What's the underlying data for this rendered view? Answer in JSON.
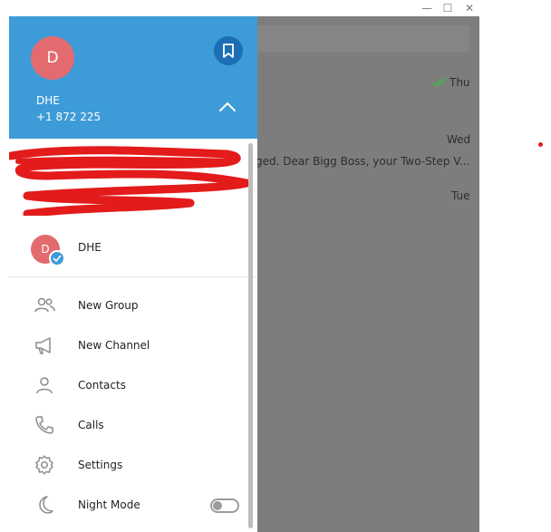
{
  "window": {
    "controls": {
      "minimize": "—",
      "maximize": "☐",
      "close": "✕"
    }
  },
  "chat_list": {
    "row1_time": "Thu",
    "row2_time": "Wed",
    "row2_snippet": "ged. Dear Bigg Boss, your Two-Step V...",
    "row3_time": "Tue"
  },
  "drawer": {
    "avatar_initial": "D",
    "user_name": "DHE",
    "phone": "+1 872 225",
    "saved_messages_icon": "bookmark-icon",
    "collapse_icon": "chevron-up-icon",
    "accounts": [
      {
        "initial": "D",
        "name": "DHE"
      }
    ],
    "menu": [
      {
        "id": "new-group",
        "label": "New Group",
        "icon": "group-icon"
      },
      {
        "id": "new-channel",
        "label": "New Channel",
        "icon": "megaphone-icon"
      },
      {
        "id": "contacts",
        "label": "Contacts",
        "icon": "person-icon"
      },
      {
        "id": "calls",
        "label": "Calls",
        "icon": "phone-icon"
      },
      {
        "id": "settings",
        "label": "Settings",
        "icon": "gear-icon"
      },
      {
        "id": "night-mode",
        "label": "Night Mode",
        "icon": "moon-icon",
        "toggle": false
      }
    ]
  },
  "colors": {
    "header_blue": "#3d9bd8",
    "avatar_red": "#e36b70",
    "overlay_gray": "#7d7d7d",
    "check_green": "#4caf50"
  }
}
